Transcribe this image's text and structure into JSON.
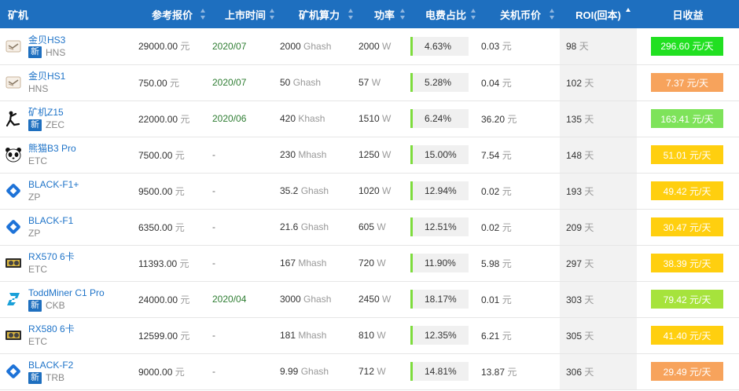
{
  "headers": {
    "miner": "矿机",
    "price": "参考报价",
    "date": "上市时间",
    "hashrate": "矿机算力",
    "power": "功率",
    "elec": "电费占比",
    "shutdown": "关机币价",
    "roi": "ROI(回本)",
    "income": "日收益"
  },
  "new_badge": "新",
  "rows": [
    {
      "name": "金贝HS3",
      "coin": "HNS",
      "is_new": true,
      "icon": "goldshell-icon",
      "price": "29000.00",
      "price_unit": "元",
      "date": "2020/07",
      "hash_val": "2000",
      "hash_unit": "Ghash",
      "power_val": "2000",
      "power_unit": "W",
      "elec": "4.63%",
      "elec_frac": 0.0463,
      "shutdown": "0.03",
      "shutdown_unit": "元",
      "roi_val": "98",
      "roi_unit": "天",
      "income": "296.60 元/天",
      "income_color": "#21e021"
    },
    {
      "name": "金贝HS1",
      "coin": "HNS",
      "is_new": false,
      "icon": "goldshell-icon",
      "price": "750.00",
      "price_unit": "元",
      "date": "2020/07",
      "hash_val": "50",
      "hash_unit": "Ghash",
      "power_val": "57",
      "power_unit": "W",
      "elec": "5.28%",
      "elec_frac": 0.0528,
      "shutdown": "0.04",
      "shutdown_unit": "元",
      "roi_val": "102",
      "roi_unit": "天",
      "income": "7.37 元/天",
      "income_color": "#f7a35c"
    },
    {
      "name": "矿机Z15",
      "coin": "ZEC",
      "is_new": true,
      "icon": "antminer-icon",
      "price": "22000.00",
      "price_unit": "元",
      "date": "2020/06",
      "hash_val": "420",
      "hash_unit": "Khash",
      "power_val": "1510",
      "power_unit": "W",
      "elec": "6.24%",
      "elec_frac": 0.0624,
      "shutdown": "36.20",
      "shutdown_unit": "元",
      "roi_val": "135",
      "roi_unit": "天",
      "income": "163.41 元/天",
      "income_color": "#7ee35a"
    },
    {
      "name": "熊猫B3 Pro",
      "coin": "ETC",
      "is_new": false,
      "icon": "panda-icon",
      "price": "7500.00",
      "price_unit": "元",
      "date": "-",
      "hash_val": "230",
      "hash_unit": "Mhash",
      "power_val": "1250",
      "power_unit": "W",
      "elec": "15.00%",
      "elec_frac": 0.15,
      "shutdown": "7.54",
      "shutdown_unit": "元",
      "roi_val": "148",
      "roi_unit": "天",
      "income": "51.01 元/天",
      "income_color": "#ffcf0f"
    },
    {
      "name": "BLACK-F1+",
      "coin": "ZP",
      "is_new": false,
      "icon": "diamond-icon",
      "price": "9500.00",
      "price_unit": "元",
      "date": "-",
      "hash_val": "35.2",
      "hash_unit": "Ghash",
      "power_val": "1020",
      "power_unit": "W",
      "elec": "12.94%",
      "elec_frac": 0.1294,
      "shutdown": "0.02",
      "shutdown_unit": "元",
      "roi_val": "193",
      "roi_unit": "天",
      "income": "49.42 元/天",
      "income_color": "#ffcf0f"
    },
    {
      "name": "BLACK-F1",
      "coin": "ZP",
      "is_new": false,
      "icon": "diamond-icon",
      "price": "6350.00",
      "price_unit": "元",
      "date": "-",
      "hash_val": "21.6",
      "hash_unit": "Ghash",
      "power_val": "605",
      "power_unit": "W",
      "elec": "12.51%",
      "elec_frac": 0.1251,
      "shutdown": "0.02",
      "shutdown_unit": "元",
      "roi_val": "209",
      "roi_unit": "天",
      "income": "30.47 元/天",
      "income_color": "#ffcf0f"
    },
    {
      "name": "RX570 6卡",
      "coin": "ETC",
      "is_new": false,
      "icon": "gpu-icon",
      "price": "11393.00",
      "price_unit": "元",
      "date": "-",
      "hash_val": "167",
      "hash_unit": "Mhash",
      "power_val": "720",
      "power_unit": "W",
      "elec": "11.90%",
      "elec_frac": 0.119,
      "shutdown": "5.98",
      "shutdown_unit": "元",
      "roi_val": "297",
      "roi_unit": "天",
      "income": "38.39 元/天",
      "income_color": "#ffcf0f"
    },
    {
      "name": "ToddMiner C1 Pro",
      "coin": "CKB",
      "is_new": true,
      "icon": "toddminer-icon",
      "price": "24000.00",
      "price_unit": "元",
      "date": "2020/04",
      "hash_val": "3000",
      "hash_unit": "Ghash",
      "power_val": "2450",
      "power_unit": "W",
      "elec": "18.17%",
      "elec_frac": 0.1817,
      "shutdown": "0.01",
      "shutdown_unit": "元",
      "roi_val": "303",
      "roi_unit": "天",
      "income": "79.42 元/天",
      "income_color": "#a6e33c"
    },
    {
      "name": "RX580 6卡",
      "coin": "ETC",
      "is_new": false,
      "icon": "gpu-icon",
      "price": "12599.00",
      "price_unit": "元",
      "date": "-",
      "hash_val": "181",
      "hash_unit": "Mhash",
      "power_val": "810",
      "power_unit": "W",
      "elec": "12.35%",
      "elec_frac": 0.1235,
      "shutdown": "6.21",
      "shutdown_unit": "元",
      "roi_val": "305",
      "roi_unit": "天",
      "income": "41.40 元/天",
      "income_color": "#ffcf0f"
    },
    {
      "name": "BLACK-F2",
      "coin": "TRB",
      "is_new": true,
      "icon": "diamond-icon",
      "price": "9000.00",
      "price_unit": "元",
      "date": "-",
      "hash_val": "9.99",
      "hash_unit": "Ghash",
      "power_val": "712",
      "power_unit": "W",
      "elec": "14.81%",
      "elec_frac": 0.1481,
      "shutdown": "13.87",
      "shutdown_unit": "元",
      "roi_val": "306",
      "roi_unit": "天",
      "income": "29.49 元/天",
      "income_color": "#f7a35c"
    }
  ]
}
